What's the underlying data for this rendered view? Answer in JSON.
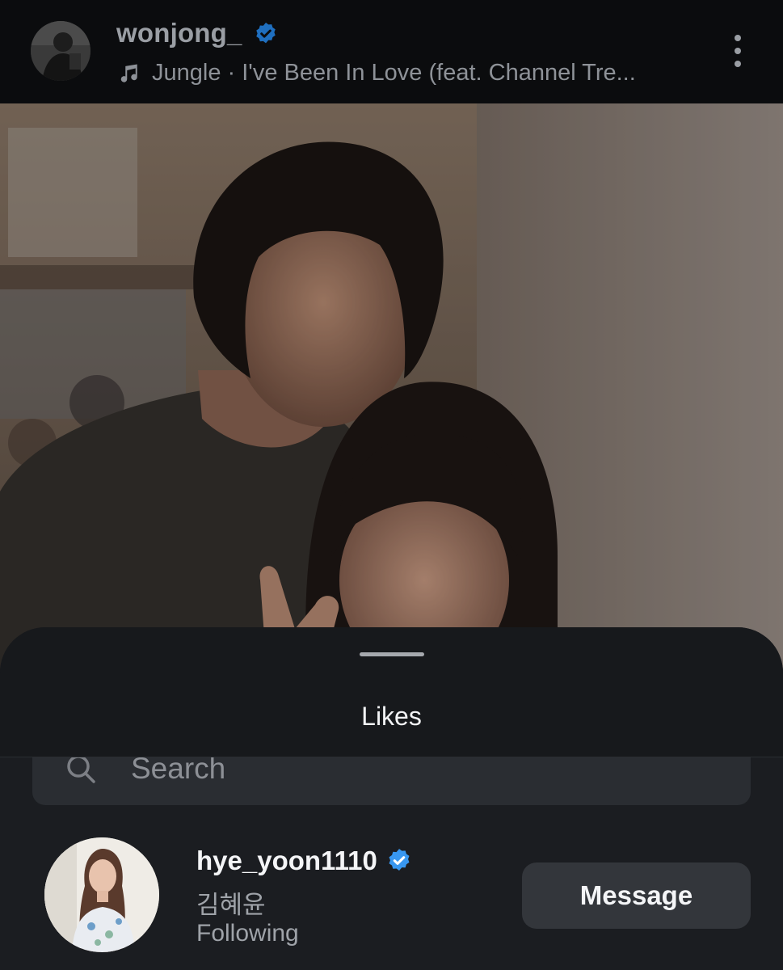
{
  "post": {
    "username": "wonjong_",
    "verified": true,
    "music_text": "Jungle · I've Been In Love (feat. Channel Tre...",
    "more_options_icon": "kebab-vertical-icon",
    "music_icon": "music-note-icon"
  },
  "likes_sheet": {
    "title": "Likes",
    "search": {
      "placeholder": "Search",
      "value": "",
      "icon": "search-icon"
    },
    "users": [
      {
        "username": "hye_yoon1110",
        "verified": true,
        "full_name": "김혜윤",
        "status": "Following",
        "action_label": "Message"
      }
    ]
  },
  "colors": {
    "header_bg": "#0b0c0e",
    "sheet_bg": "#1b1d21",
    "verified_blue": "#3897f0",
    "button_bg": "#33363b"
  }
}
